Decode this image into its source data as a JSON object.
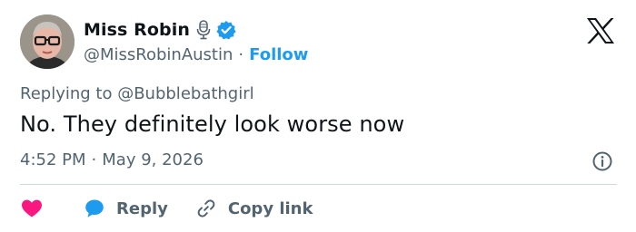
{
  "author": {
    "display_name": "Miss Robin",
    "handle": "@MissRobinAustin",
    "separator": "·",
    "follow_label": "Follow"
  },
  "reply_context": {
    "prefix": "Replying to ",
    "mention": "@Bubblebathgirl"
  },
  "tweet": {
    "text": "No. They definitely look worse now",
    "time": "4:52 PM",
    "separator": "·",
    "date": "May 9, 2026"
  },
  "actions": {
    "reply_label": "Reply",
    "copy_link_label": "Copy link"
  },
  "icons": {
    "mic": "microphone-icon",
    "verified": "verified-badge-icon",
    "logo": "x-logo-icon",
    "info": "info-icon",
    "like": "heart-icon",
    "reply": "speech-bubble-icon",
    "copy": "link-icon"
  },
  "colors": {
    "accent": "#1d9bf0",
    "like": "#f91880",
    "secondary_text": "#536471",
    "primary_text": "#0f1419",
    "divider": "#cfd9de"
  }
}
